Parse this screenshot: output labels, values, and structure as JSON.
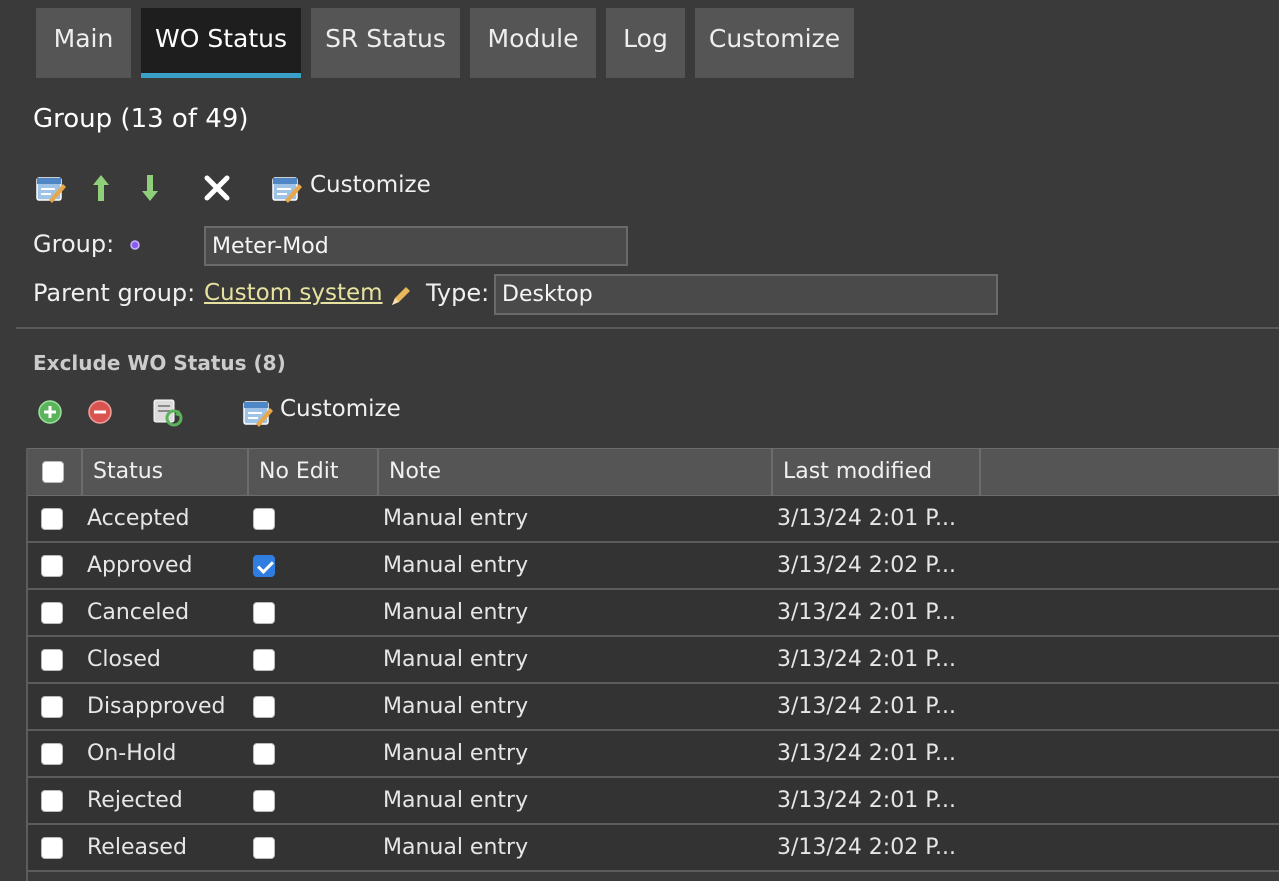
{
  "tabs": [
    {
      "label": "Main"
    },
    {
      "label": "WO Status"
    },
    {
      "label": "SR Status"
    },
    {
      "label": "Module"
    },
    {
      "label": "Log"
    },
    {
      "label": "Customize"
    }
  ],
  "active_tab": "WO Status",
  "group_title": "Group (13 of 49)",
  "toolbar": {
    "icons": [
      "edit-icon",
      "move-up-icon",
      "move-down-icon",
      "delete-icon",
      "customize-icon"
    ],
    "customize_label": "Customize"
  },
  "form": {
    "group_label": "Group:",
    "group_value": "Meter-Mod",
    "parent_label": "Parent group:",
    "parent_link": "Custom system",
    "type_label": "Type:",
    "type_value": "Desktop"
  },
  "exclude_section": {
    "title": "Exclude WO Status (8)",
    "icons": [
      "add-icon",
      "remove-icon",
      "refresh-icon",
      "customize-icon"
    ],
    "customize_label": "Customize"
  },
  "grid": {
    "headers": [
      "Status",
      "No Edit",
      "Note",
      "Last modified"
    ],
    "rows": [
      {
        "status": "Accepted",
        "no_edit": false,
        "note": "Manual entry",
        "modified": "3/13/24 2:01 P..."
      },
      {
        "status": "Approved",
        "no_edit": true,
        "note": "Manual entry",
        "modified": "3/13/24 2:02 P..."
      },
      {
        "status": "Canceled",
        "no_edit": false,
        "note": "Manual entry",
        "modified": "3/13/24 2:01 P..."
      },
      {
        "status": "Closed",
        "no_edit": false,
        "note": "Manual entry",
        "modified": "3/13/24 2:01 P..."
      },
      {
        "status": "Disapproved",
        "no_edit": false,
        "note": "Manual entry",
        "modified": "3/13/24 2:01 P..."
      },
      {
        "status": "On-Hold",
        "no_edit": false,
        "note": "Manual entry",
        "modified": "3/13/24 2:01 P..."
      },
      {
        "status": "Rejected",
        "no_edit": false,
        "note": "Manual entry",
        "modified": "3/13/24 2:01 P..."
      },
      {
        "status": "Released",
        "no_edit": false,
        "note": "Manual entry",
        "modified": "3/13/24 2:02 P..."
      }
    ]
  },
  "colors": {
    "background": "#3a3a3a",
    "tab": "#555555",
    "active_tab": "#1e1e1e",
    "accent": "#3aa0c8",
    "link": "#e8e2a0",
    "checkbox_checked": "#2f7de1"
  }
}
